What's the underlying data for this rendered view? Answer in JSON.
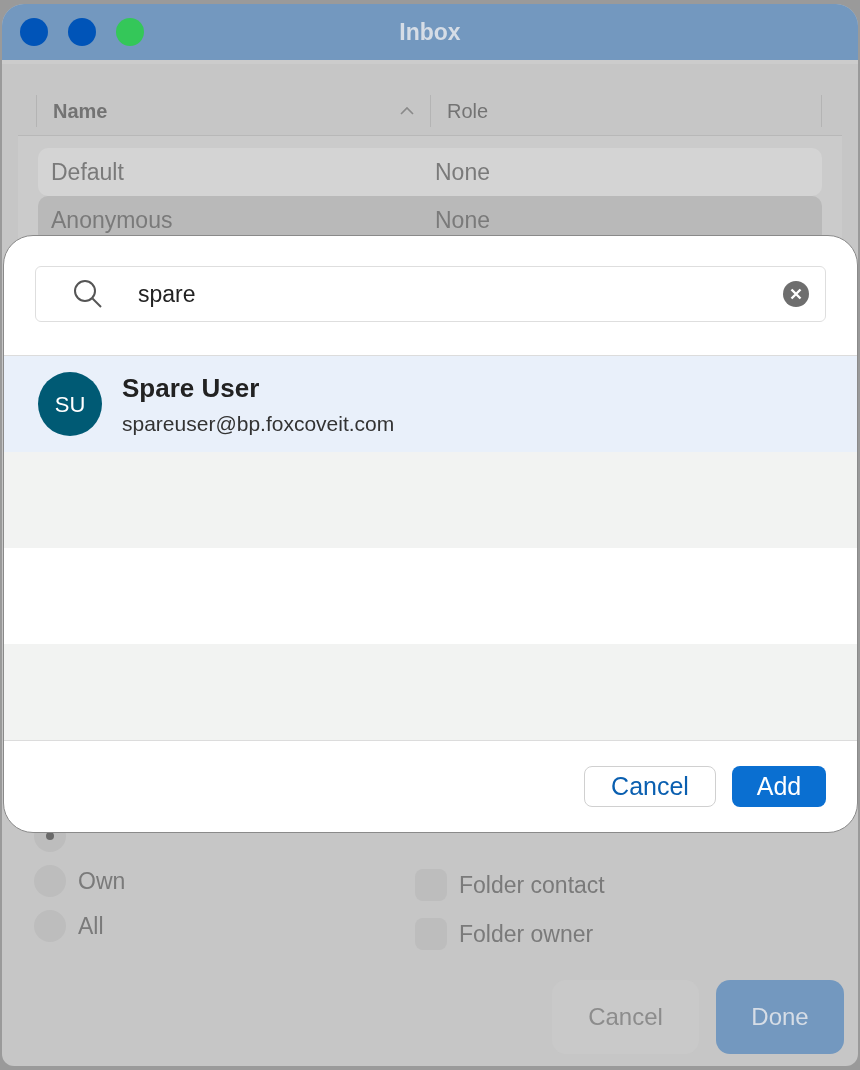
{
  "window": {
    "title": "Inbox",
    "controls": [
      {
        "color": "#0054b8"
      },
      {
        "color": "#0054b8"
      },
      {
        "color": "#34c759"
      }
    ]
  },
  "table": {
    "columns": [
      {
        "label": "Name",
        "sorted": true
      },
      {
        "label": "Role",
        "sorted": false
      }
    ],
    "rows": [
      {
        "name": "Default",
        "role": "None",
        "selected": false
      },
      {
        "name": "Anonymous",
        "role": "None",
        "selected": true
      }
    ]
  },
  "read_access": [
    {
      "selected": true
    },
    {
      "label": "Own",
      "selected": false
    },
    {
      "label": "All",
      "selected": false
    }
  ],
  "permissions": [
    {
      "label": "Folder contact",
      "checked": false
    },
    {
      "label": "Folder owner",
      "checked": false
    }
  ],
  "buttons": [
    {
      "label": "Cancel",
      "kind": "secondary"
    },
    {
      "label": "Done",
      "kind": "primary"
    }
  ],
  "dialog": {
    "search": {
      "value": "spare"
    },
    "results": [
      {
        "initials": "SU",
        "name": "Spare User",
        "email": "spareuser@bp.foxcoveit.com",
        "selected": true
      }
    ],
    "buttons": [
      {
        "label": "Cancel",
        "kind": "secondary"
      },
      {
        "label": "Add",
        "kind": "primary"
      }
    ]
  }
}
